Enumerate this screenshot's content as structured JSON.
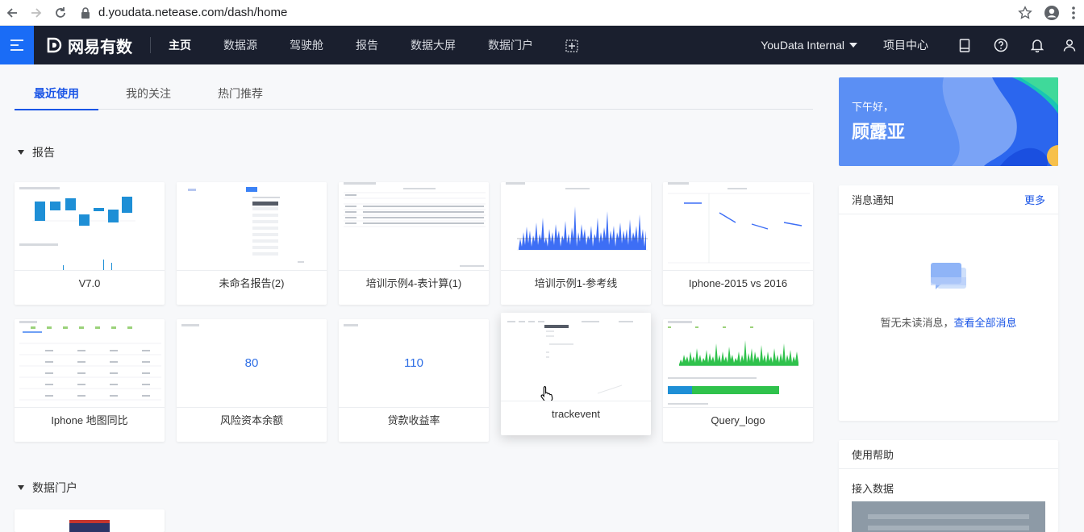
{
  "browser": {
    "url": "d.youdata.netease.com/dash/home"
  },
  "header": {
    "logo_text": "网易有数",
    "nav": [
      "主页",
      "数据源",
      "驾驶舱",
      "报告",
      "数据大屏",
      "数据门户"
    ],
    "active_nav": "主页",
    "workspace": "YouData Internal",
    "project_center": "项目中心",
    "colors": {
      "bg": "#1a1f2e",
      "accent": "#1a6cf6"
    }
  },
  "tabs": [
    "最近使用",
    "我的关注",
    "热门推荐"
  ],
  "sections": {
    "reports_title": "报告",
    "portal_title": "数据门户"
  },
  "reports": [
    {
      "label": "V7.0"
    },
    {
      "label": "未命名报告(2)"
    },
    {
      "label": "培训示例4-表计算(1)"
    },
    {
      "label": "培训示例1-参考线"
    },
    {
      "label": "Iphone-2015 vs 2016"
    },
    {
      "label": "Iphone 地图同比"
    },
    {
      "label": "风险资本余额",
      "value": "80"
    },
    {
      "label": "贷款收益率",
      "value": "110"
    },
    {
      "label": "trackevent"
    },
    {
      "label": "Query_logo"
    }
  ],
  "greeting": {
    "line1": "下午好，",
    "name": "顾露亚"
  },
  "notifications": {
    "title": "消息通知",
    "more": "更多",
    "empty_text": "暂无未读消息，",
    "view_all": "查看全部消息"
  },
  "help": {
    "title": "使用帮助",
    "item": "接入数据"
  }
}
